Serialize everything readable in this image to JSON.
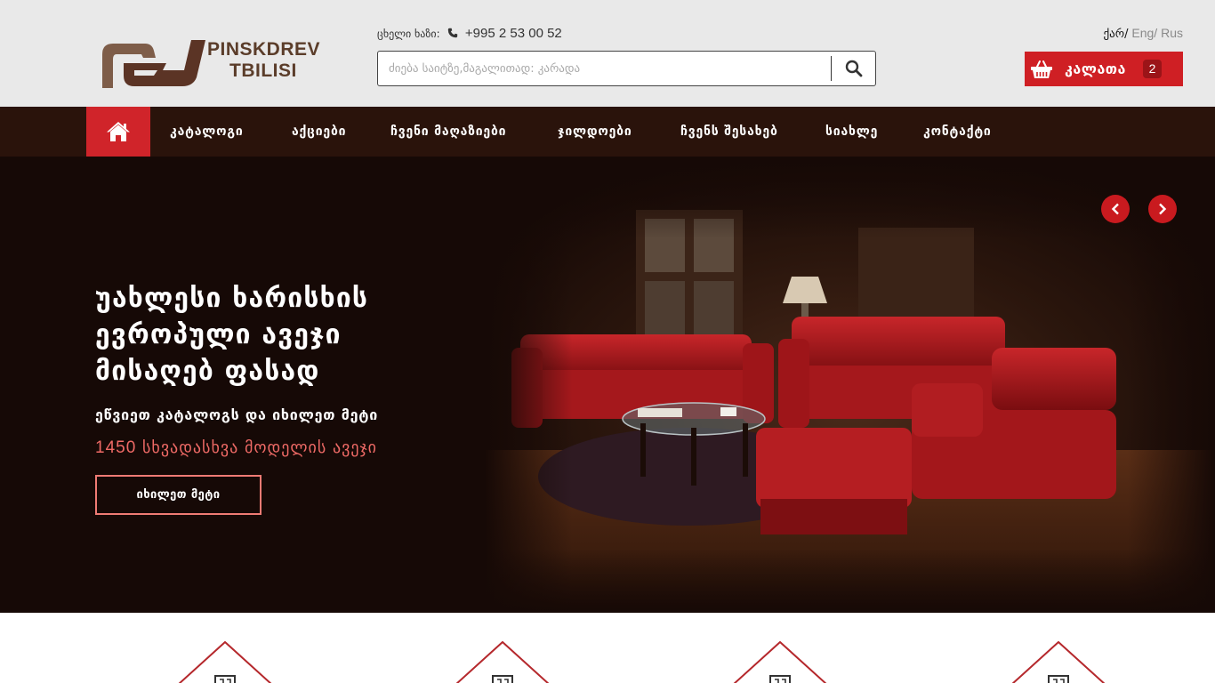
{
  "header": {
    "logo": {
      "line1": "PINSKDREV",
      "line2": "TBILISI",
      "icon": "pinskdrev-logo-icon"
    },
    "hotline": {
      "label": "ცხელი ხაზი:",
      "icon": "phone-icon",
      "number": "+995 2 53 00 52"
    },
    "search": {
      "placeholder": "ძიება საიტზე,მაგალითად: კარადა",
      "value": "",
      "icon": "search-icon"
    },
    "languages": {
      "active": "ქარ/",
      "eng": "Eng/",
      "rus": "Rus"
    },
    "cart": {
      "label": "კალათა",
      "count": "2",
      "icon": "basket-icon"
    }
  },
  "nav": {
    "home_icon": "home-icon",
    "items": [
      {
        "label": "კატალოგი"
      },
      {
        "label": "აქციები"
      },
      {
        "label": "ჩვენი მაღაზიები"
      },
      {
        "label": "ჯილდოები"
      },
      {
        "label": "ჩვენს შესახებ"
      },
      {
        "label": "სიახლე"
      },
      {
        "label": "კონტაქტი"
      }
    ]
  },
  "hero": {
    "title_lines": [
      "უახლესი ხარისხის",
      "ევროპული ავეჯი",
      "მისაღებ ფასად"
    ],
    "subtitle": "ეწვიეთ კატალოგს და იხილეთ მეტი",
    "models_count": "1450",
    "models_text": "სხვადასხვა მოდელის ავეჯი",
    "button_label": "იხილეთ მეტი",
    "prev_icon": "chevron-left-icon",
    "next_icon": "chevron-right-icon"
  },
  "colors": {
    "accent_red": "#cf1f24",
    "nav_brown": "#2a130b",
    "hero_dark": "#160906",
    "logo_brown": "#5b3d2a",
    "highlight_pink": "#ef6a66"
  }
}
